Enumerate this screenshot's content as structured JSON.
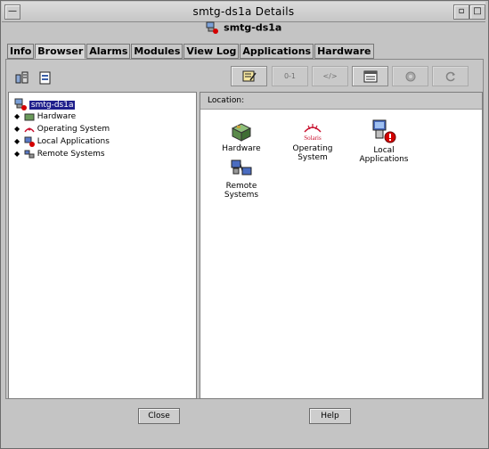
{
  "window": {
    "title": "smtg-ds1a Details",
    "minimize_glyph": "—",
    "maximize_glyph": "▫",
    "close_glyph": "×"
  },
  "header": {
    "host": "smtg-ds1a"
  },
  "tabs": [
    {
      "label": "Info"
    },
    {
      "label": "Browser"
    },
    {
      "label": "Alarms"
    },
    {
      "label": "Modules"
    },
    {
      "label": "View Log"
    },
    {
      "label": "Applications"
    },
    {
      "label": "Hardware"
    }
  ],
  "active_tab": "Browser",
  "toolbar": {
    "btn_disabled_1": "0-1",
    "btn_disabled_2": "</>"
  },
  "tree": {
    "root": "smtg-ds1a",
    "children": [
      {
        "label": "Hardware"
      },
      {
        "label": "Operating System"
      },
      {
        "label": "Local Applications"
      },
      {
        "label": "Remote Systems"
      }
    ]
  },
  "location": {
    "label": "Location:"
  },
  "content_items": [
    {
      "label": "Hardware"
    },
    {
      "label": "Operating System",
      "logo_text": "Solaris"
    },
    {
      "label": "Local Applications"
    },
    {
      "label": "Remote Systems"
    }
  ],
  "buttons": {
    "close": "Close",
    "help": "Help"
  },
  "colors": {
    "selection": "#1f1f8c",
    "alarm": "#d40000",
    "solaris_red": "#c8102e"
  }
}
